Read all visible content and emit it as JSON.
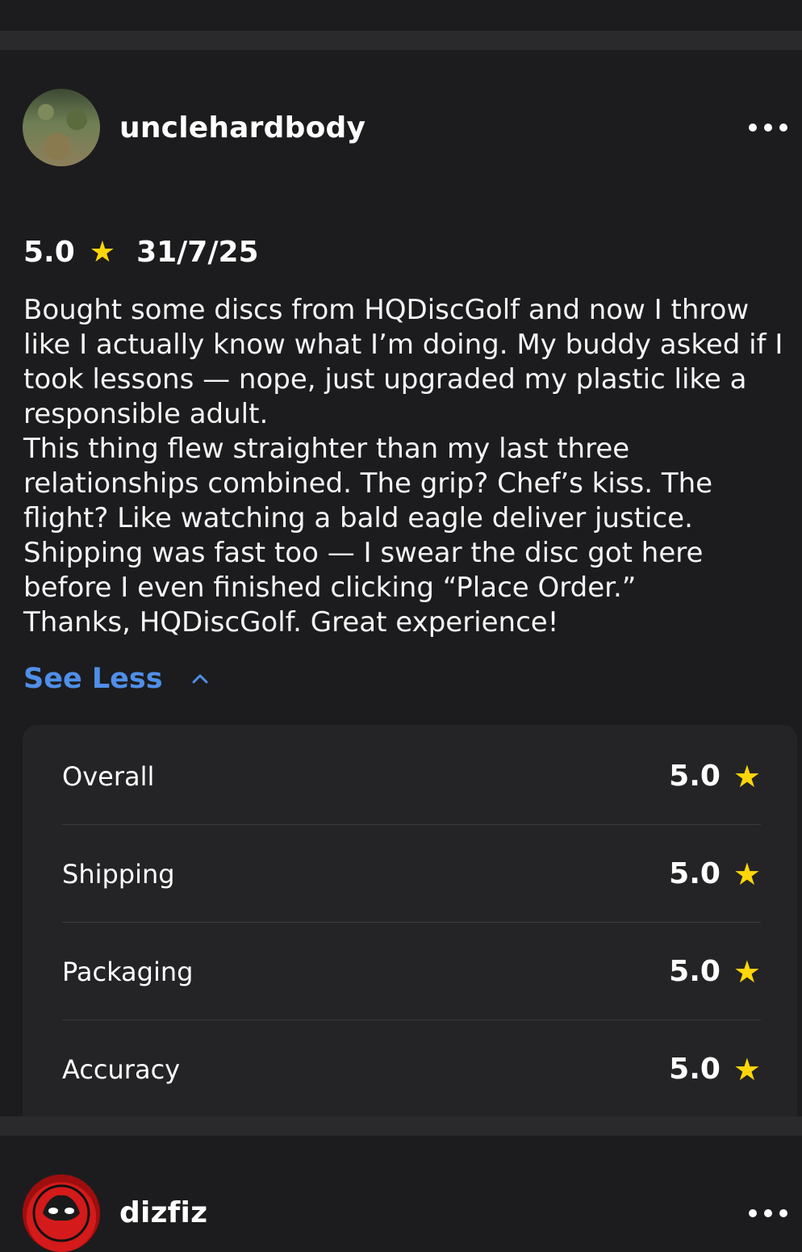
{
  "reviews": [
    {
      "username": "unclehardbody",
      "rating": "5.0",
      "date": "31/7/25",
      "text": "Bought some discs from HQDiscGolf and now I throw like I actually know what I’m doing. My buddy asked if I took lessons — nope, just upgraded my plastic like a responsible adult.\nThis thing flew straighter than my last three relationships combined. The grip? Chef’s kiss. The flight? Like watching a bald eagle deliver justice. Shipping was fast too — I swear the disc got here before I even finished clicking “Place Order.”\nThanks, HQDiscGolf. Great experience!",
      "see_less_label": "See Less",
      "subratings": [
        {
          "label": "Overall",
          "value": "5.0"
        },
        {
          "label": "Shipping",
          "value": "5.0"
        },
        {
          "label": "Packaging",
          "value": "5.0"
        },
        {
          "label": "Accuracy",
          "value": "5.0"
        }
      ]
    },
    {
      "username": "dizfiz"
    }
  ],
  "colors": {
    "background": "#1c1c1e",
    "separator": "#2a2a2c",
    "card": "#242426",
    "accent": "#4f8fe8",
    "star": "#ffd60a"
  },
  "icons": {
    "more": "more-icon",
    "star": "star-icon",
    "chevron": "chevron-up-icon"
  }
}
